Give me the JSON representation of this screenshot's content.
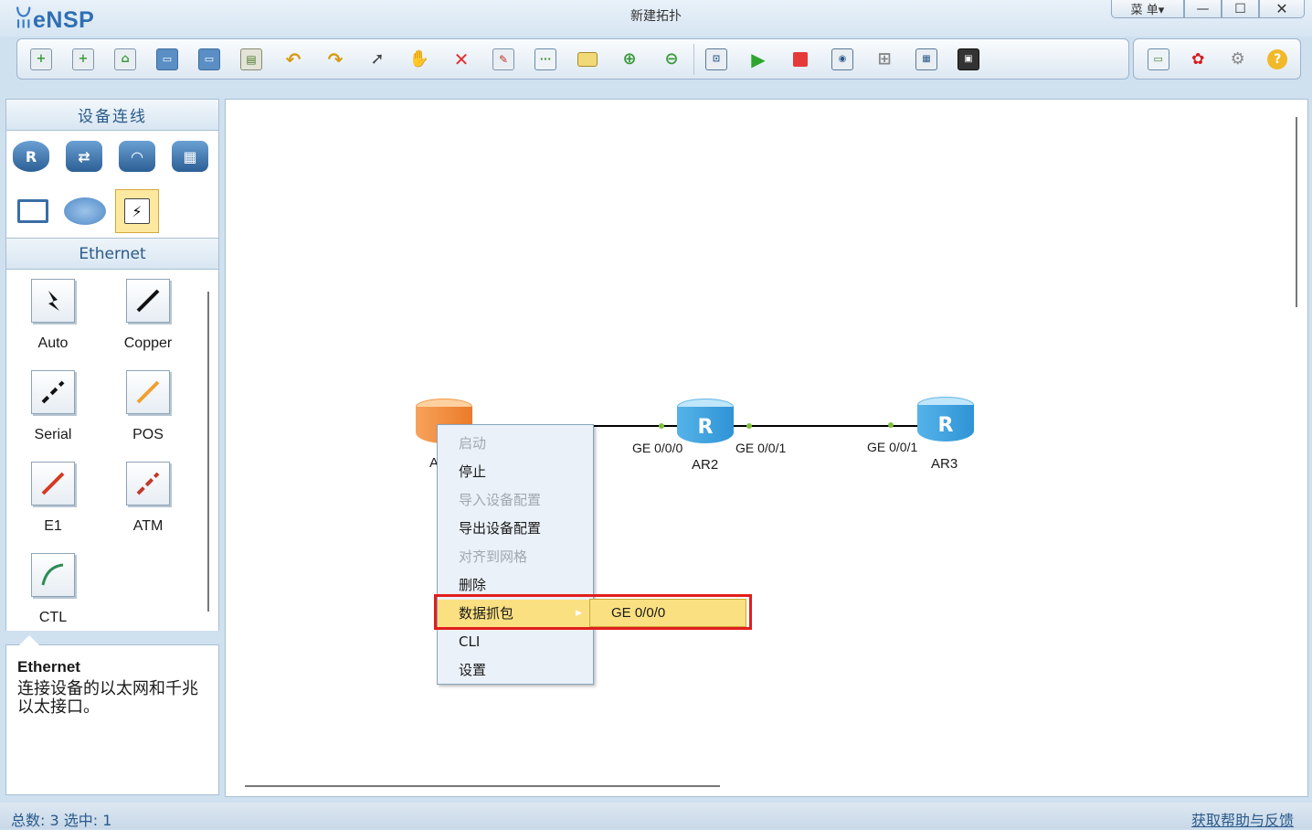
{
  "app": {
    "logo": "eNSP",
    "window_title": "新建拓扑"
  },
  "window_controls": {
    "menu": "菜 单▾",
    "minimize": "—",
    "maximize": "☐",
    "close": "✕"
  },
  "toolbar": {
    "icons": [
      "new-topology-icon",
      "new-device-icon",
      "open-icon",
      "save-icon",
      "save-as-icon",
      "print-icon",
      "undo-icon",
      "redo-icon",
      "select-icon",
      "pan-hand-icon",
      "delete-icon",
      "delete-link-icon",
      "text-note-icon",
      "rectangle-icon",
      "zoom-in-icon",
      "zoom-out-icon",
      "fit-view-icon",
      "start-device-icon",
      "stop-device-icon",
      "capture-icon",
      "topology-icon",
      "grid-icon",
      "screenshot-icon"
    ],
    "right_icons": [
      "message-icon",
      "huawei-icon",
      "settings-icon",
      "help-icon"
    ]
  },
  "left_panel": {
    "devices_title": "设备连线",
    "selected_category": "Ethernet",
    "cables": [
      {
        "label": "Auto",
        "color": "#111111"
      },
      {
        "label": "Copper",
        "color": "#111111"
      },
      {
        "label": "Serial",
        "color": "#111111"
      },
      {
        "label": "POS",
        "color": "#f0a030"
      },
      {
        "label": "E1",
        "color": "#d53a22"
      },
      {
        "label": "ATM",
        "color": "#c0392b"
      },
      {
        "label": "CTL",
        "color": "#2e8b57"
      }
    ],
    "info": {
      "title": "Ethernet",
      "description": "连接设备的以太网和千兆以太接口。"
    }
  },
  "topology": {
    "nodes": [
      {
        "id": "AR1",
        "label": "A",
        "color": "orange"
      },
      {
        "id": "AR2",
        "label": "AR2",
        "color": "blue"
      },
      {
        "id": "AR3",
        "label": "AR3",
        "color": "blue"
      }
    ],
    "ports": [
      "GE 0/0/0",
      "GE 0/0/1",
      "GE 0/0/1"
    ]
  },
  "context_menu": {
    "items": [
      {
        "label": "启动",
        "enabled": false
      },
      {
        "label": "停止",
        "enabled": true
      },
      {
        "label": "导入设备配置",
        "enabled": false
      },
      {
        "label": "导出设备配置",
        "enabled": true
      },
      {
        "label": "对齐到网格",
        "enabled": false
      },
      {
        "label": "删除",
        "enabled": true
      },
      {
        "label": "数据抓包",
        "enabled": true,
        "highlighted": true,
        "has_submenu": true
      },
      {
        "label": "CLI",
        "enabled": true
      },
      {
        "label": "设置",
        "enabled": true
      }
    ],
    "submenu": {
      "item": "GE 0/0/0"
    }
  },
  "status": {
    "summary": "总数: 3  选中: 1",
    "help_link": "获取帮助与反馈"
  }
}
